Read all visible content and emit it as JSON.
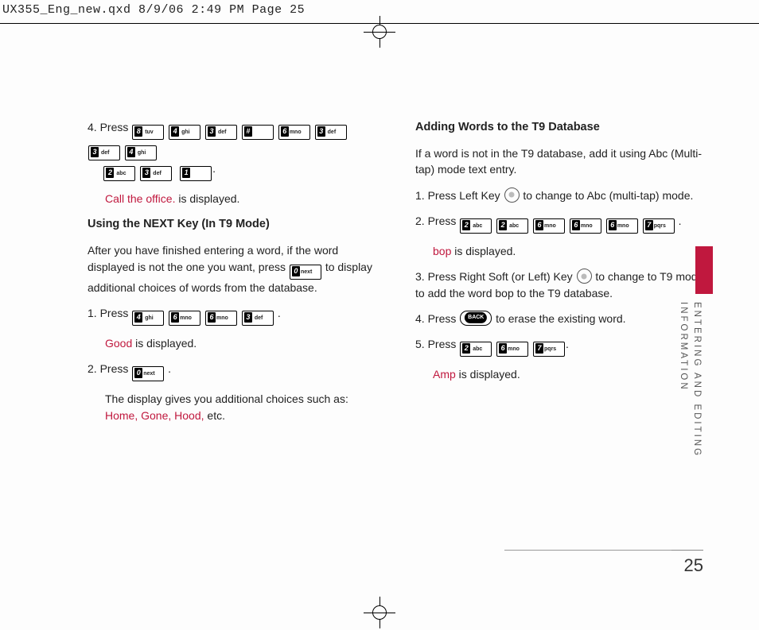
{
  "print_header": {
    "file": "UX355_Eng_new.qxd",
    "date": "8/9/06",
    "time": "2:49 PM",
    "page": "Page 25"
  },
  "keys": {
    "k0": "0next",
    "k1": "1",
    "k2": "2 abc",
    "k3": "3 def",
    "k4": "4 ghi",
    "k6": "6mno",
    "k7": "7pqrs",
    "k8": "8 tuv",
    "hash": "#"
  },
  "left": {
    "step4_a": "4. Press ",
    "step4_b": ".",
    "call_office_a": "Call the office.",
    "call_office_b": " is displayed.",
    "h_next": "Using the NEXT Key (In T9 Mode)",
    "next_p1": "After you have finished entering a word, if the word displayed is not the one you want, press ",
    "next_p1b": " to display additional choices of words from the database.",
    "s1a": "1. Press ",
    "s1b": " .",
    "good_a": "Good",
    "good_b": " is displayed.",
    "s2a": "2. Press ",
    "s2b": " .",
    "s2c_a": "The display gives you additional choices such as: ",
    "s2c_red": "Home, Gone, Hood,",
    "s2c_b": " etc."
  },
  "right": {
    "h_add": "Adding Words to the T9 Database",
    "p1": "If a word is not in the T9 database, add it using Abc (Multi-tap) mode text entry.",
    "r1a": "1. Press Left Key ",
    "r1b": " to change to Abc (multi-tap) mode.",
    "r2a": "2. Press ",
    "r2b": " .",
    "bop_a": "bop",
    "bop_b": " is displayed.",
    "r3a": "3. Press Right Soft (or Left) Key ",
    "r3b": " to change to T9 mode to add the word bop to the T9 database.",
    "r4a": "4. Press ",
    "r4b": " to erase the existing word.",
    "r5a": "5. Press ",
    "r5b": ".",
    "amp_a": "Amp",
    "amp_b": " is displayed."
  },
  "side": {
    "l1": "ENTERING AND EDITING",
    "l2": "INFORMATION"
  },
  "page_number": "25"
}
